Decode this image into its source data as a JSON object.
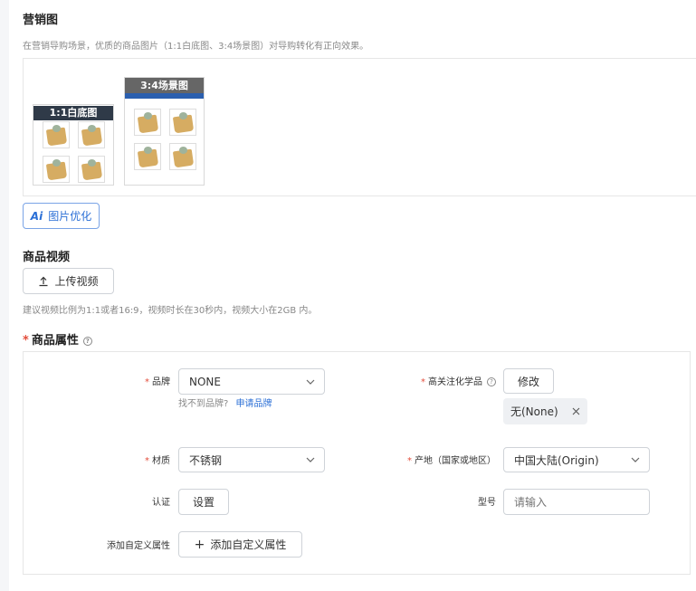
{
  "marketing": {
    "title": "营销图",
    "hint": "在营销导购场景，优质的商品图片（1:1白底图、3:4场景图）对导购转化有正向效果。",
    "thumb_1_1_label": "1:1白底图",
    "thumb_3_4_label": "3:4场景图",
    "ai_optimize_label": "图片优化"
  },
  "video": {
    "title": "商品视频",
    "upload_label": "上传视频",
    "hint": "建议视频比例为1:1或者16:9，视频时长在30秒内，视频大小在2GB 内。"
  },
  "attributes": {
    "title": "商品属性",
    "brand_label": "品牌",
    "brand_value": "NONE",
    "brand_not_found": "找不到品牌?",
    "brand_apply_link": "申请品牌",
    "chem_label": "高关注化学品",
    "chem_modify": "修改",
    "chem_tag": "无(None)",
    "material_label": "材质",
    "material_value": "不锈钢",
    "origin_label": "产地（国家或地区）",
    "origin_value": "中国大陆(Origin)",
    "cert_label": "认证",
    "cert_button": "设置",
    "model_label": "型号",
    "model_placeholder": "请输入",
    "custom_label": "添加自定义属性",
    "custom_button": "添加自定义属性"
  },
  "colors": {
    "accent": "#2b6fd6",
    "required": "#e34d3b",
    "thumb_header_dark": "#2f3a48",
    "thumb_header_gray": "#666666",
    "thumb_strip_blue": "#2b5fae"
  }
}
